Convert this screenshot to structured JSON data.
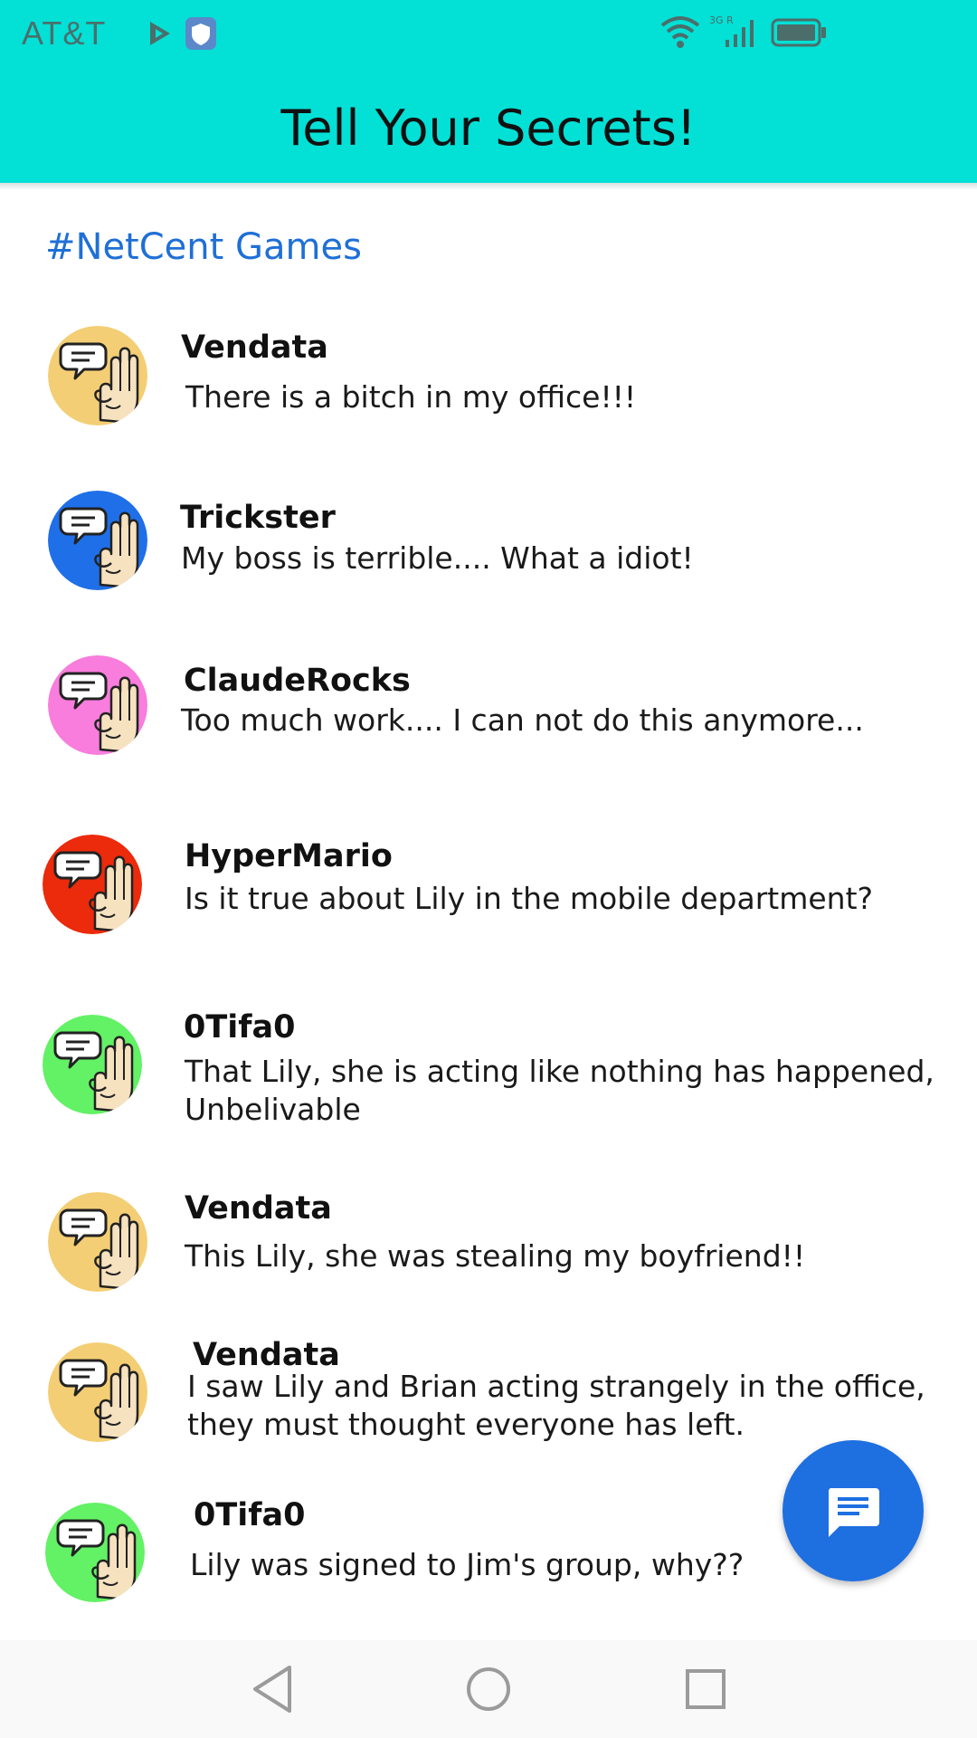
{
  "status_bar": {
    "carrier": "AT&T",
    "network": "3G R"
  },
  "app": {
    "title": "Tell Your Secrets!"
  },
  "channel": {
    "name": "#NetCent Games"
  },
  "posts": [
    {
      "author": "Vendata",
      "message": "There is a bitch in my office!!!",
      "avatar_color": "#f4ce74"
    },
    {
      "author": "Trickster",
      "message": "My boss is terrible.... What a idiot!",
      "avatar_color": "#1f6fe8"
    },
    {
      "author": "ClaudeRocks",
      "message": "Too much work.... I can not do this anymore...",
      "avatar_color": "#f87ddc"
    },
    {
      "author": "HyperMario",
      "message": "Is it true about Lily in the mobile department?",
      "avatar_color": "#ec2a0c"
    },
    {
      "author": "0Tifa0",
      "message": "That Lily, she is acting like nothing has happened, Unbelivable",
      "avatar_color": "#63f165"
    },
    {
      "author": "Vendata",
      "message": "This Lily, she was stealing my boyfriend!!",
      "avatar_color": "#f4ce74"
    },
    {
      "author": "Vendata",
      "message": "I saw Lily and Brian acting strangely in the office, they must thought everyone has left.",
      "avatar_color": "#f4ce74"
    },
    {
      "author": "0Tifa0",
      "message": "Lily was signed to Jim's group, why??",
      "avatar_color": "#63f165"
    }
  ],
  "colors": {
    "header": "#03e0d6",
    "channel_link": "#1f6fd6",
    "fab": "#1e6fe0"
  },
  "icons": {
    "fab": "message-icon",
    "avatar": "raised-hand-speech-icon",
    "nav": [
      "back-icon",
      "home-icon",
      "recents-icon"
    ]
  }
}
